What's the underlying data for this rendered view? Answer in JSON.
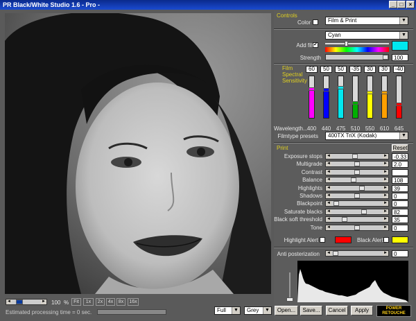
{
  "window": {
    "title": "PR Black/White Studio 1.6 - Pro -"
  },
  "controls": {
    "header": "Controls",
    "color_label": "Color",
    "mode_select": "Film & Print",
    "filter_select": "Cyan",
    "add_filter_label": "Add filter",
    "add_filter_checked": "✔",
    "strength_label": "Strength",
    "strength_value": "100",
    "filter_swatch": "#00e8f0"
  },
  "film": {
    "header_lines": [
      "Film",
      "Spectral",
      "Sensitivity"
    ],
    "channels": [
      {
        "value": "60",
        "wavelength": "400",
        "color": "#ff00ff",
        "level": 0.72
      },
      {
        "value": "50",
        "wavelength": "440",
        "color": "#0000ff",
        "level": 0.7
      },
      {
        "value": "50",
        "wavelength": "475",
        "color": "#00e8f0",
        "level": 0.75
      },
      {
        "value": "-35",
        "wavelength": "510",
        "color": "#00b000",
        "level": 0.35
      },
      {
        "value": "30",
        "wavelength": "550",
        "color": "#ffff00",
        "level": 0.62
      },
      {
        "value": "30",
        "wavelength": "610",
        "color": "#ffa000",
        "level": 0.62
      },
      {
        "value": "-40",
        "wavelength": "645",
        "color": "#ff0000",
        "level": 0.32
      }
    ],
    "wavelength_label": "Wavelength...",
    "presets_label": "Filmtype presets",
    "presets_value": "400TX TriX (Kodak)"
  },
  "print": {
    "header": "Print",
    "reset_label": "Reset",
    "rows": [
      {
        "label": "Exposure stops",
        "value": "-0.33",
        "level": 0.45
      },
      {
        "label": "Multigrade",
        "value": "2.0",
        "level": 0.5
      },
      {
        "label": "Contrast",
        "value": "",
        "level": 0.5
      },
      {
        "label": "Balance",
        "value": "108",
        "level": 0.42
      },
      {
        "label": "Highlights",
        "value": "39",
        "level": 0.6
      },
      {
        "label": "Shadows",
        "value": "0",
        "level": 0.5
      },
      {
        "label": "Blackpoint",
        "value": "0",
        "level": 0.05
      },
      {
        "label": "Saturate blacks",
        "value": "82",
        "level": 0.65
      },
      {
        "label": "Black soft threshold",
        "value": "35",
        "level": 0.22
      },
      {
        "label": "Tone",
        "value": "0",
        "level": 0.5
      }
    ],
    "highlight_alert_label": "Highlight Alert",
    "highlight_alert_color": "#ff0000",
    "black_alert_label": "Black Alert",
    "black_alert_color": "#ffff00"
  },
  "anti": {
    "label": "Anti posterization",
    "value": "0",
    "level": 0.02
  },
  "bottom": {
    "zoom_value": "100",
    "zoom_unit": "%",
    "zoom_buttons": [
      "Fit",
      "1x",
      "2x",
      "4x",
      "8x",
      "16x"
    ],
    "status": "Estimated processing time = 0 sec.",
    "size_select": "Full",
    "mode_select": "Grey",
    "open_label": "Open...",
    "save_label": "Save...",
    "cancel_label": "Cancel",
    "apply_label": "Apply",
    "logo_line1": "POWER",
    "logo_line2": "RETOUCHE"
  }
}
